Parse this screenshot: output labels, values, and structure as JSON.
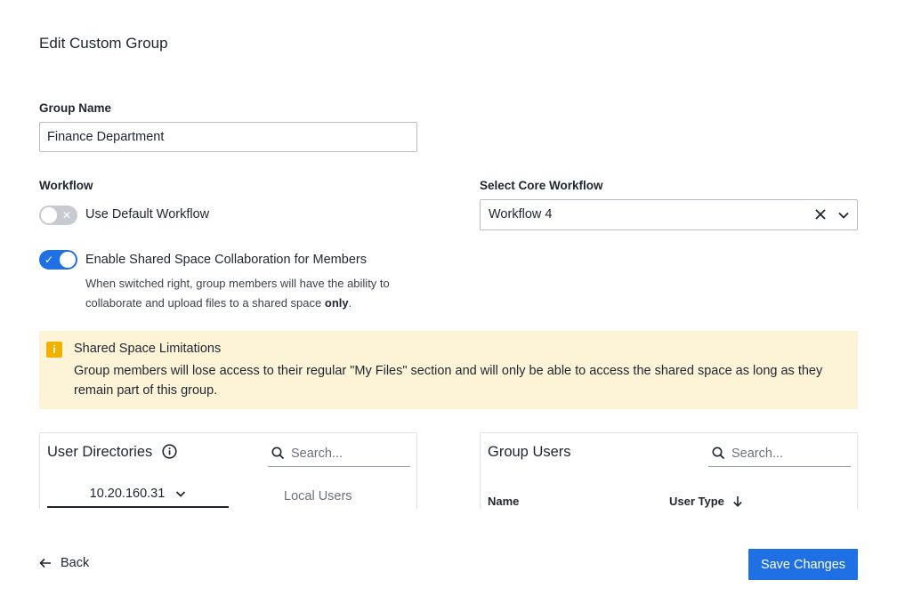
{
  "page": {
    "title": "Edit Custom Group"
  },
  "group_name": {
    "label": "Group Name",
    "value": "Finance Department"
  },
  "workflow": {
    "label": "Workflow",
    "default_toggle_label": "Use Default Workflow",
    "default_toggle_on": false
  },
  "core_workflow": {
    "label": "Select Core Workflow",
    "value": "Workflow 4"
  },
  "shared_space": {
    "toggle_label": "Enable Shared Space Collaboration for Members",
    "toggle_on": true,
    "help_text_start": "When switched right, group members will have the ability to collaborate and upload files to a shared space",
    "help_text_emph": "only",
    "help_text_end": "."
  },
  "alert": {
    "title": "Shared Space Limitations",
    "body": "Group members will lose access to their regular \"My Files\" section and will only be able to access the shared space as long as they remain part of this group."
  },
  "user_directories": {
    "title": "User Directories",
    "search_placeholder": "Search...",
    "directory_tab": "10.20.160.31",
    "local_tab": "Local Users"
  },
  "group_users": {
    "title": "Group Users",
    "search_placeholder": "Search...",
    "columns": [
      "Name",
      "User Type"
    ]
  },
  "footer": {
    "back_label": "Back",
    "save_label": "Save Changes"
  },
  "colors": {
    "primary": "#1f6fe5",
    "alert_bg": "#fdf4d8",
    "alert_icon": "#f2b100"
  }
}
